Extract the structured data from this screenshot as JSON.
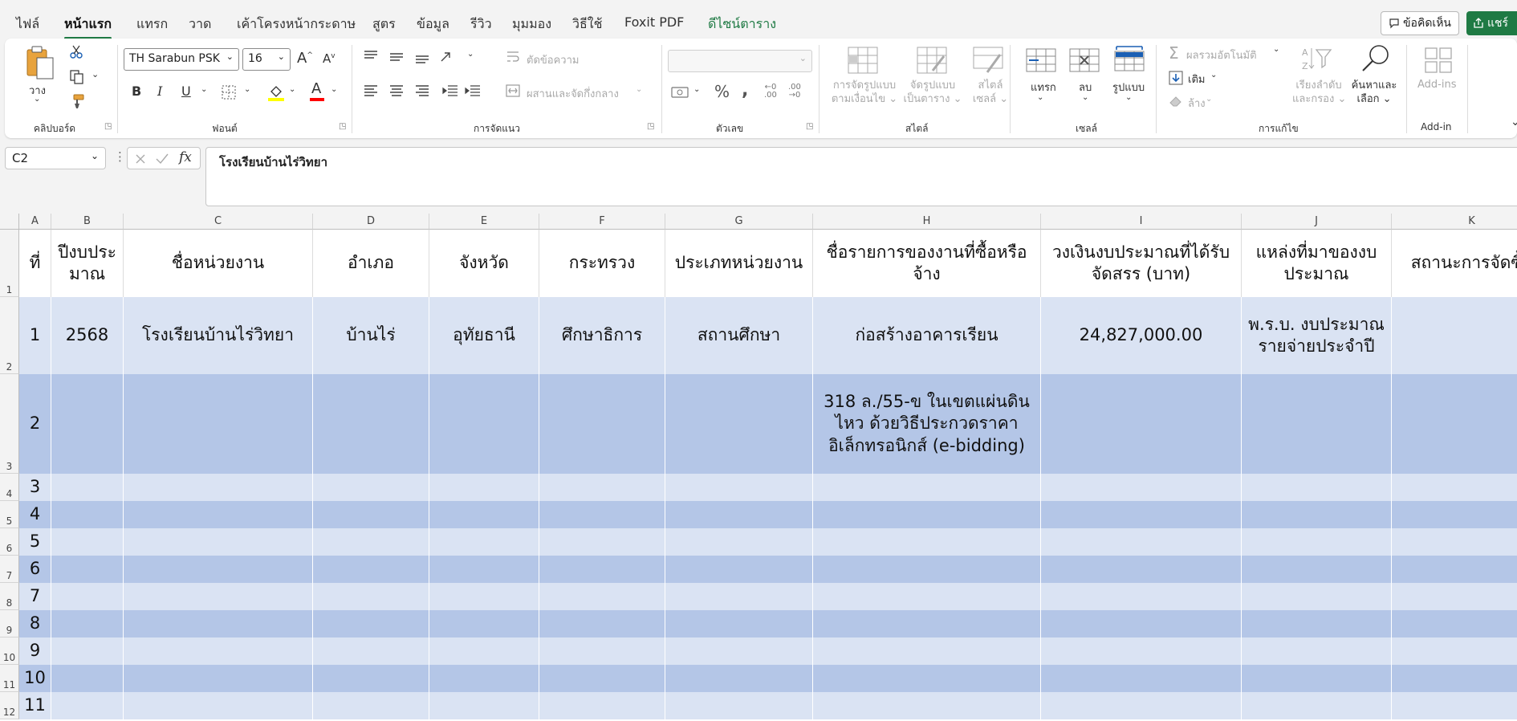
{
  "menu": {
    "tabs": [
      "ไฟล์",
      "หน้าแรก",
      "แทรก",
      "วาด",
      "เค้าโครงหน้ากระดาษ",
      "สูตร",
      "ข้อมูล",
      "รีวิว",
      "มุมมอง",
      "วิธีใช้",
      "Foxit PDF",
      "ดีไซน์ตาราง"
    ],
    "comments_label": "ข้อคิดเห็น",
    "share_label": "แชร์"
  },
  "ribbon": {
    "clipboard": {
      "paste_label": "วาง",
      "group_label": "คลิปบอร์ด"
    },
    "font": {
      "name": "TH Sarabun PSK",
      "size": "16",
      "group_label": "ฟอนต์"
    },
    "alignment": {
      "wrap_text": "ตัดข้อความ",
      "merge_center": "ผสานและจัดกึ่งกลาง",
      "group_label": "การจัดแนว"
    },
    "number": {
      "format": "",
      "group_label": "ตัวเลข"
    },
    "styles": {
      "conditional_formatting": [
        "การจัดรูปแบบ",
        "ตามเงื่อนไข"
      ],
      "format_as_table": [
        "จัดรูปแบบ",
        "เป็นตาราง"
      ],
      "cell_styles": [
        "สไตล์",
        "เซลล์"
      ],
      "group_label": "สไตล์"
    },
    "cells": {
      "insert": "แทรก",
      "delete": "ลบ",
      "format": "รูปแบบ",
      "group_label": "เซลล์"
    },
    "editing": {
      "autosum": "ผลรวมอัตโนมัติ",
      "fill": "เติม",
      "clear": "ล้าง",
      "sort_filter": [
        "เรียงลำดับ",
        "และกรอง"
      ],
      "find_select": [
        "ค้นหาและ",
        "เลือก"
      ],
      "group_label": "การแก้ไข"
    },
    "addins": {
      "label": "Add-ins",
      "group_label": "Add-in"
    }
  },
  "formula_bar": {
    "name_box": "C2",
    "fx": "fx",
    "content": "โรงเรียนบ้านไร่วิทยา"
  },
  "sheet": {
    "columns": [
      "A",
      "B",
      "C",
      "D",
      "E",
      "F",
      "G",
      "H",
      "I",
      "J",
      "K"
    ],
    "header_row": [
      "ที่",
      "ปีงบประ มาณ",
      "ชื่อหน่วยงาน",
      "อำเภอ",
      "จังหวัด",
      "กระทรวง",
      "ประเภทหน่วยงาน",
      "ชื่อรายการของงานที่ซื้อหรือจ้าง",
      "วงเงินงบประมาณที่ได้รับจัดสรร (บาท)",
      "แหล่งที่มาของงบประมาณ",
      "สถานะการจัดซื้อ"
    ],
    "rows": [
      {
        "num": "2",
        "cells": [
          "1",
          "2568",
          "โรงเรียนบ้านไร่วิทยา",
          "บ้านไร่",
          "อุทัยธานี",
          "ศึกษาธิการ",
          "สถานศึกษา",
          "ก่อสร้างอาคารเรียน",
          "24,827,000.00",
          "พ.ร.บ. งบประมาณรายจ่ายประจำปี",
          ""
        ]
      },
      {
        "num": "3",
        "cells": [
          "2",
          "",
          "",
          "",
          "",
          "",
          "",
          "318 ล./55-ข ในเขตแผ่นดินไหว ด้วยวิธีประกวดราคาอิเล็กทรอนิกส์ (e-bidding)",
          "",
          "",
          ""
        ]
      },
      {
        "num": "4",
        "cells": [
          "3",
          "",
          "",
          "",
          "",
          "",
          "",
          "",
          "",
          "",
          ""
        ]
      },
      {
        "num": "5",
        "cells": [
          "4",
          "",
          "",
          "",
          "",
          "",
          "",
          "",
          "",
          "",
          ""
        ]
      },
      {
        "num": "6",
        "cells": [
          "5",
          "",
          "",
          "",
          "",
          "",
          "",
          "",
          "",
          "",
          ""
        ]
      },
      {
        "num": "7",
        "cells": [
          "6",
          "",
          "",
          "",
          "",
          "",
          "",
          "",
          "",
          "",
          ""
        ]
      },
      {
        "num": "8",
        "cells": [
          "7",
          "",
          "",
          "",
          "",
          "",
          "",
          "",
          "",
          "",
          ""
        ]
      },
      {
        "num": "9",
        "cells": [
          "8",
          "",
          "",
          "",
          "",
          "",
          "",
          "",
          "",
          "",
          ""
        ]
      },
      {
        "num": "10",
        "cells": [
          "9",
          "",
          "",
          "",
          "",
          "",
          "",
          "",
          "",
          "",
          ""
        ]
      },
      {
        "num": "11",
        "cells": [
          "10",
          "",
          "",
          "",
          "",
          "",
          "",
          "",
          "",
          "",
          ""
        ]
      },
      {
        "num": "12",
        "cells": [
          "11",
          "",
          "",
          "",
          "",
          "",
          "",
          "",
          "",
          "",
          ""
        ]
      }
    ],
    "header_row_num": "1",
    "colors": {
      "band_light": "#dae3f3",
      "band_dark": "#b4c6e7",
      "header_bg": "#ffffff"
    }
  }
}
